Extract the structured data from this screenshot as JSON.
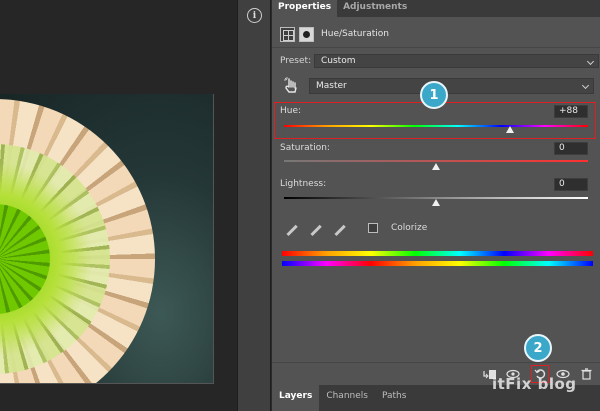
{
  "panel": {
    "tabs": [
      {
        "label": "Properties",
        "active": true
      },
      {
        "label": "Adjustments",
        "active": false
      }
    ],
    "header_title": "Hue/Saturation",
    "preset_label": "Preset:",
    "preset_value": "Custom",
    "channel_value": "Master",
    "sliders": {
      "hue": {
        "label": "Hue:",
        "value": "+88",
        "range": [
          -180,
          180
        ],
        "num": 88
      },
      "saturation": {
        "label": "Saturation:",
        "value": "0",
        "range": [
          -100,
          100
        ],
        "num": 0
      },
      "lightness": {
        "label": "Lightness:",
        "value": "0",
        "range": [
          -100,
          100
        ],
        "num": 0
      }
    },
    "colorize_label": "Colorize",
    "colorize_checked": false
  },
  "callouts": {
    "one": "1",
    "two": "2"
  },
  "bottom_tabs": [
    {
      "label": "Layers",
      "active": true
    },
    {
      "label": "Channels",
      "active": false
    },
    {
      "label": "Paths",
      "active": false
    }
  ],
  "watermark": "itFix blog",
  "colors": {
    "highlight": "#e02020",
    "callout": "#3ba8c9",
    "panel": "#535353"
  },
  "icons": [
    "info-icon",
    "adjustment-grid-icon",
    "layer-mask-icon",
    "targeted-adjustment-hand-icon",
    "eyedropper-icon",
    "eyedropper-plus-icon",
    "eyedropper-minus-icon",
    "clip-to-layer-icon",
    "view-previous-state-icon",
    "reset-icon",
    "visibility-eye-icon",
    "trash-icon"
  ]
}
